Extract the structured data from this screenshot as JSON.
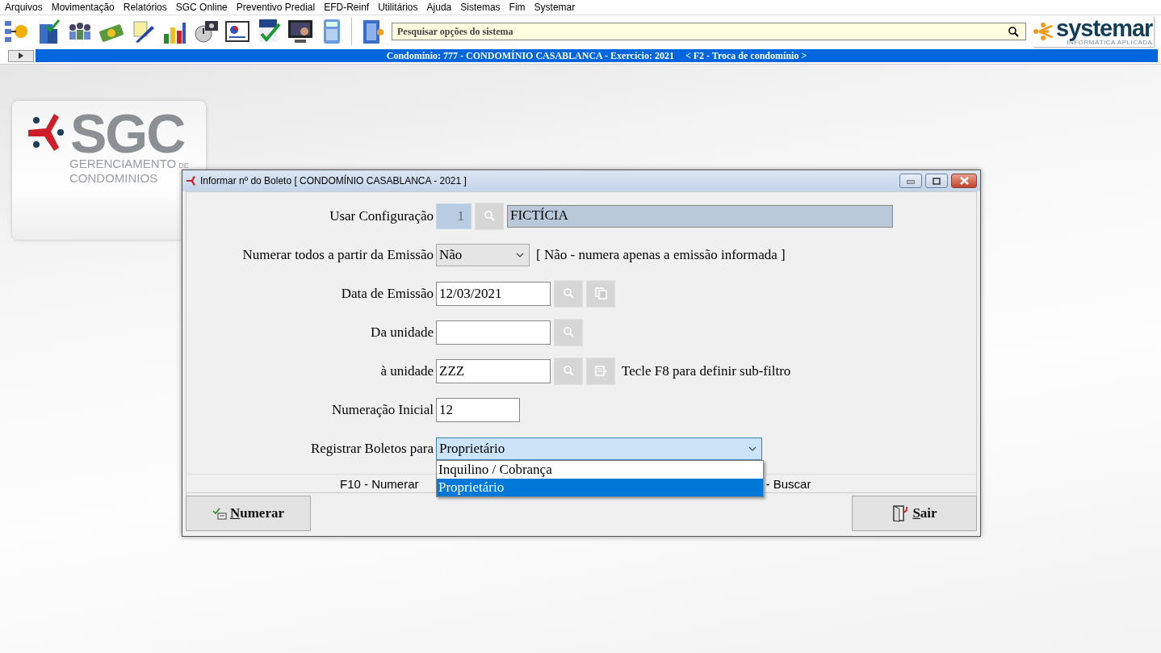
{
  "menu": [
    {
      "label": "Arquivos"
    },
    {
      "label": "Movimentação"
    },
    {
      "label": "Relatórios"
    },
    {
      "label": "SGC Online"
    },
    {
      "label": "Preventivo Predial"
    },
    {
      "label": "EFD-Reinf"
    },
    {
      "label": "Utilitários"
    },
    {
      "label": "Ajuda"
    },
    {
      "label": "Sistemas"
    },
    {
      "label": "Fim"
    },
    {
      "label": "Systemar"
    }
  ],
  "toolbar": {
    "search": {
      "placeholder": "Pesquisar opções do sistema"
    }
  },
  "brand": {
    "name": "systemar",
    "tagline": "INFORMÁTICA APLICADA"
  },
  "context_bar": {
    "text": "Condomínio: 777 - CONDOMÍNIO CASABLANCA - Exercício: 2021",
    "hint": "< F2 - Troca de condomínio >"
  },
  "logo": {
    "name": "SGC",
    "line_1": "GERENCIAMENTO",
    "line_1_suffix": "DE",
    "line_2": "CONDOMINIOS"
  },
  "dialog": {
    "title": "Informar nº do Boleto [ CONDOMÍNIO CASABLANCA - 2021 ]",
    "fields": [
      {
        "kind": "config",
        "label": "Usar Configuração",
        "code": "1",
        "value": "FICTÍCIA"
      },
      {
        "kind": "select",
        "label": "Numerar todos a partir da Emissão",
        "value": "Não",
        "note": "[ Não - numera apenas a emissão informada ]"
      },
      {
        "kind": "date",
        "label": "Data de Emissão",
        "value": "12/03/2021"
      },
      {
        "kind": "lookup",
        "label": "Da unidade"
      },
      {
        "kind": "lookup_filter",
        "label": "à unidade",
        "value": "ZZZ",
        "note": "Tecle F8 para definir sub-filtro"
      },
      {
        "kind": "number",
        "label": "Numeração Inicial",
        "value": "12"
      },
      {
        "kind": "dropdown",
        "label": "Registrar Boletos para",
        "value": "Proprietário",
        "expanded": true,
        "options": [
          {
            "label": "Inquilino / Cobrança",
            "selected": false
          },
          {
            "label": "Proprietário",
            "selected": true
          }
        ]
      }
    ],
    "hints": [
      "F10 - Numerar",
      "- Buscar"
    ],
    "buttons": [
      {
        "kind": "numerar",
        "label": "Numerar"
      },
      {
        "kind": "exit",
        "label": "Sair"
      }
    ]
  }
}
